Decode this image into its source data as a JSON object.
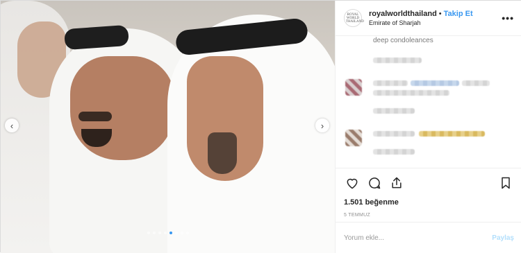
{
  "post": {
    "username": "royalworldthailand",
    "separator": "•",
    "follow_label": "Takip Et",
    "location": "Emirate of Sharjah",
    "avatar_text": "ROYAL WORLD THAILAND",
    "more_icon": "more-options-icon",
    "more_label": "•••"
  },
  "media": {
    "prev_label": "‹",
    "next_label": "›",
    "carousel_total": 8,
    "carousel_active": 5
  },
  "comments": {
    "caption_tail": "deep condoleances"
  },
  "actions": {
    "icons": [
      "heart-icon",
      "comment-icon",
      "share-icon",
      "bookmark-icon"
    ],
    "likes": "1.501 beğenme",
    "date": "5 TEMMUZ"
  },
  "comment_box": {
    "placeholder": "Yorum ekle...",
    "post_label": "Paylaş"
  },
  "colors": {
    "accent": "#3897f0",
    "post_button_disabled": "#b2dffc"
  }
}
